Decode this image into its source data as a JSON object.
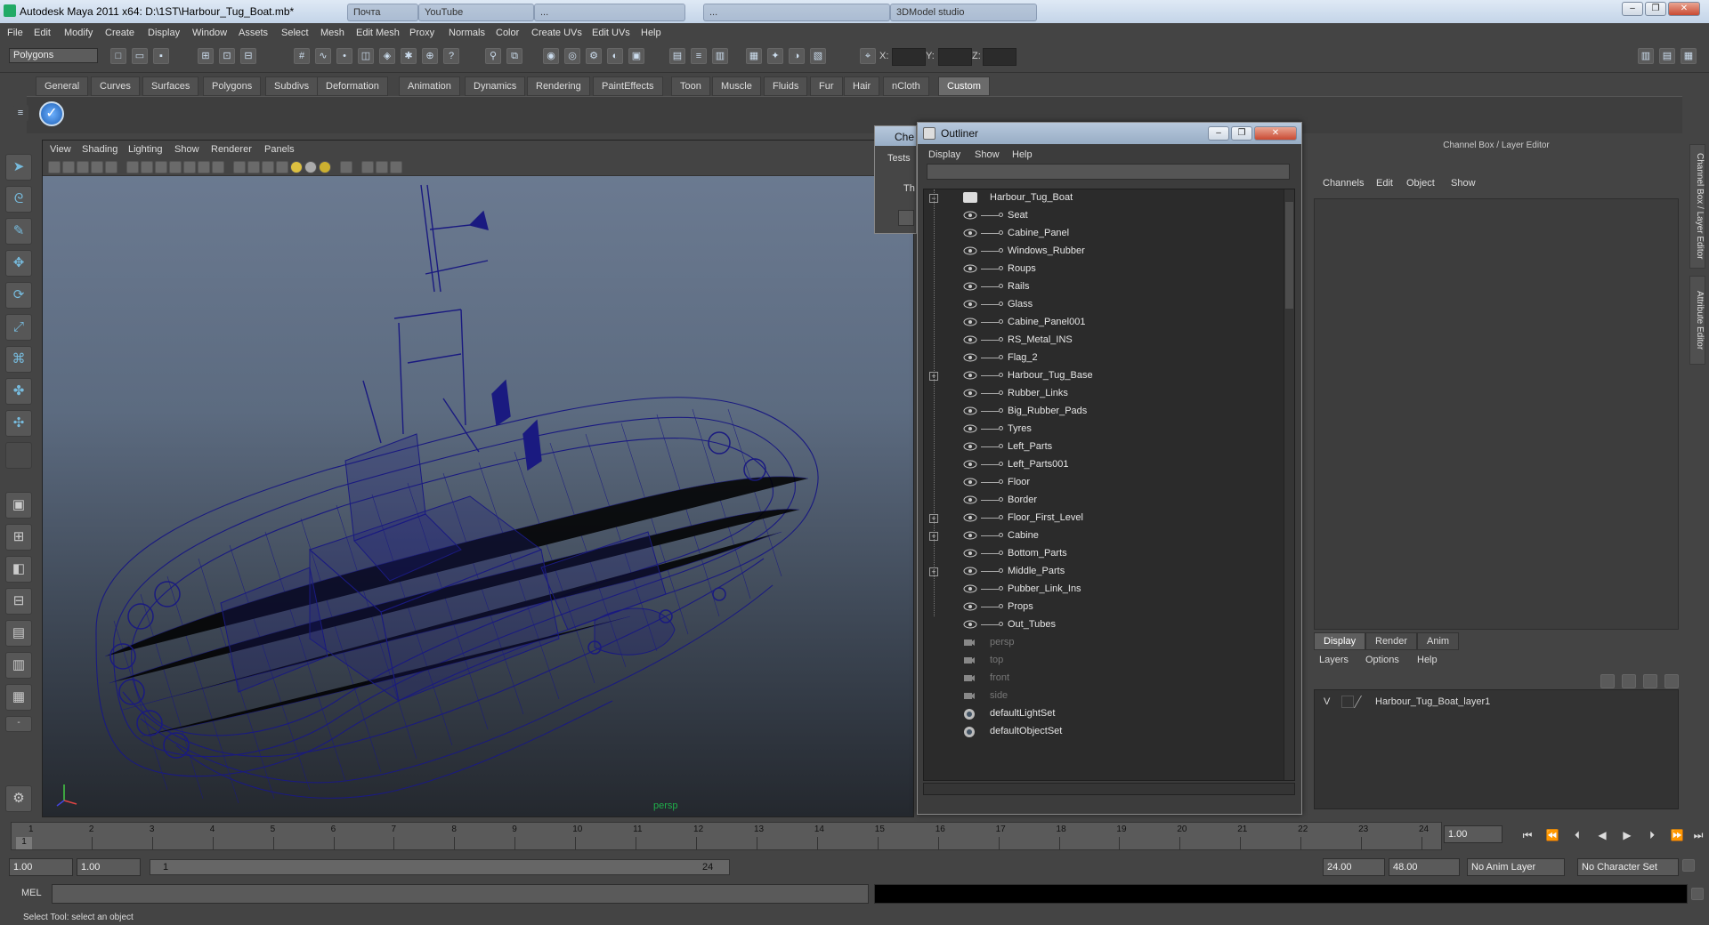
{
  "window": {
    "title": "Autodesk Maya 2011 x64: D:\\1ST\\Harbour_Tug_Boat.mb*",
    "taskbar_tabs": [
      "Почта",
      "YouTube",
      "...",
      "...",
      "3DModel studio"
    ]
  },
  "menubar": [
    "File",
    "Edit",
    "Modify",
    "Create",
    "Display",
    "Window",
    "Assets",
    "Select",
    "Mesh",
    "Edit Mesh",
    "Proxy",
    "Normals",
    "Color",
    "Create UVs",
    "Edit UVs",
    "Help"
  ],
  "toolbar": {
    "mode_select": "Polygons",
    "coord_labels": [
      "X:",
      "Y:",
      "Z:"
    ]
  },
  "shelf_tabs": [
    "General",
    "Curves",
    "Surfaces",
    "Polygons",
    "Subdivs",
    "Deformation",
    "Animation",
    "Dynamics",
    "Rendering",
    "PaintEffects",
    "Toon",
    "Muscle",
    "Fluids",
    "Fur",
    "Hair",
    "nCloth",
    "Custom"
  ],
  "shelf_active": "Custom",
  "viewport": {
    "menu": [
      "View",
      "Shading",
      "Lighting",
      "Show",
      "Renderer",
      "Panels"
    ],
    "camera_label": "persp",
    "wire_color": "#1a1a80"
  },
  "check_window": {
    "title": "Che",
    "tests_label": "Tests",
    "body_text": "Th"
  },
  "outliner": {
    "title": "Outliner",
    "menu": [
      "Display",
      "Show",
      "Help"
    ],
    "root": "Harbour_Tug_Boat",
    "items": [
      {
        "label": "Seat",
        "expandable": false
      },
      {
        "label": "Cabine_Panel",
        "expandable": false
      },
      {
        "label": "Windows_Rubber",
        "expandable": false
      },
      {
        "label": "Roups",
        "expandable": false
      },
      {
        "label": "Rails",
        "expandable": false
      },
      {
        "label": "Glass",
        "expandable": false
      },
      {
        "label": "Cabine_Panel001",
        "expandable": false
      },
      {
        "label": "RS_Metal_INS",
        "expandable": false
      },
      {
        "label": "Flag_2",
        "expandable": false
      },
      {
        "label": "Harbour_Tug_Base",
        "expandable": true
      },
      {
        "label": "Rubber_Links",
        "expandable": false
      },
      {
        "label": "Big_Rubber_Pads",
        "expandable": false
      },
      {
        "label": "Tyres",
        "expandable": false
      },
      {
        "label": "Left_Parts",
        "expandable": false
      },
      {
        "label": "Left_Parts001",
        "expandable": false
      },
      {
        "label": "Floor",
        "expandable": false
      },
      {
        "label": "Border",
        "expandable": false
      },
      {
        "label": "Floor_First_Level",
        "expandable": true
      },
      {
        "label": "Cabine",
        "expandable": true
      },
      {
        "label": "Bottom_Parts",
        "expandable": false
      },
      {
        "label": "Middle_Parts",
        "expandable": true
      },
      {
        "label": "Pubber_Link_Ins",
        "expandable": false
      },
      {
        "label": "Props",
        "expandable": false
      },
      {
        "label": "Out_Tubes",
        "expandable": false
      }
    ],
    "cameras": [
      "persp",
      "top",
      "front",
      "side"
    ],
    "sets": [
      "defaultLightSet",
      "defaultObjectSet"
    ]
  },
  "channel_box": {
    "title": "Channel Box / Layer Editor",
    "menu": [
      "Channels",
      "Edit",
      "Object",
      "Show"
    ],
    "layer_tabs": [
      "Display",
      "Render",
      "Anim"
    ],
    "layer_tab_active": "Display",
    "layer_menu": [
      "Layers",
      "Options",
      "Help"
    ],
    "layer_visibility": "V",
    "layer_name": "Harbour_Tug_Boat_layer1",
    "side_tabs": [
      "Channel Box / Layer Editor",
      "Attribute Editor"
    ]
  },
  "timeline": {
    "ticks": [
      "1",
      "2",
      "3",
      "4",
      "5",
      "6",
      "7",
      "8",
      "9",
      "10",
      "11",
      "12",
      "13",
      "14",
      "15",
      "16",
      "17",
      "18",
      "19",
      "20",
      "21",
      "22",
      "23",
      "24"
    ],
    "current_frame": "1",
    "current_time_field": "1.00"
  },
  "range": {
    "start_time": "1.00",
    "start_playback": "1.00",
    "range_start_label": "1",
    "range_end_label": "24",
    "end_playback": "24.00",
    "end_time": "48.00",
    "anim_layer": "No Anim Layer",
    "character_set": "No Character Set"
  },
  "command_line": {
    "label": "MEL"
  },
  "status": {
    "help_line": "Select Tool: select an object"
  }
}
